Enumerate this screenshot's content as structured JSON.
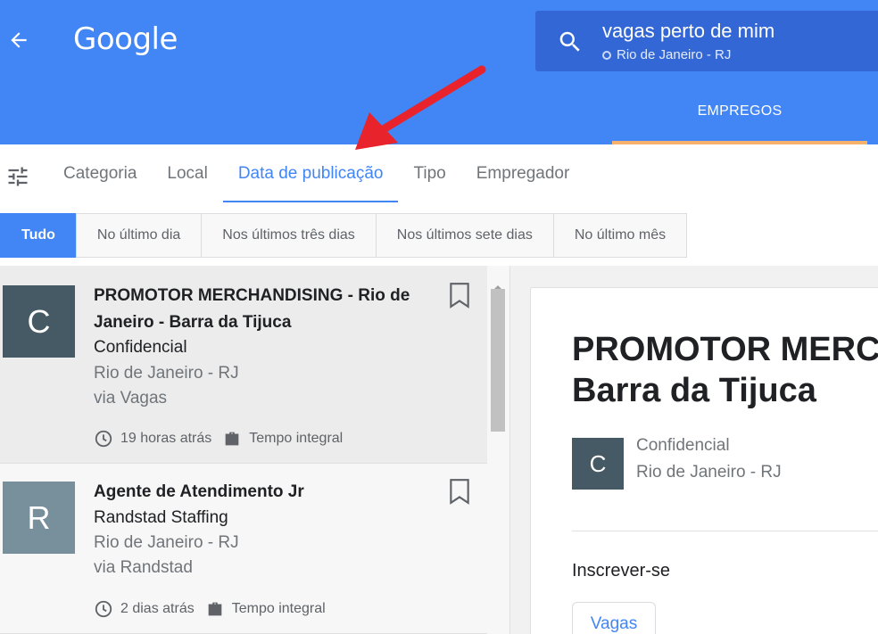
{
  "header": {
    "logo": "Google",
    "search": {
      "query": "vagas perto de mim",
      "location": "Rio de Janeiro - RJ"
    },
    "tab_label": "EMPREGOS"
  },
  "filters": {
    "tabs": [
      "Categoria",
      "Local",
      "Data de publicação",
      "Tipo",
      "Empregador"
    ],
    "active_tab": "Data de publicação",
    "chips": [
      "Tudo",
      "No último dia",
      "Nos últimos três dias",
      "Nos últimos sete dias",
      "No último mês"
    ],
    "active_chip": "Tudo"
  },
  "jobs": [
    {
      "avatar_letter": "C",
      "title": "PROMOTOR MERCHANDISING - Rio de Janeiro - Barra da Tijuca",
      "company": "Confidencial",
      "location": "Rio de Janeiro - RJ",
      "source": "via Vagas",
      "posted": "19 horas atrás",
      "type": "Tempo integral"
    },
    {
      "avatar_letter": "R",
      "title": "Agente de Atendimento Jr",
      "company": "Randstad Staffing",
      "location": "Rio de Janeiro - RJ",
      "source": "via Randstad",
      "posted": "2 dias atrás",
      "type": "Tempo integral"
    }
  ],
  "detail": {
    "title_line1": "PROMOTOR MERCHANDISING - Rio de Janeiro -",
    "title_line2": "Barra da Tijuca",
    "avatar_letter": "C",
    "company": "Confidencial",
    "location": "Rio de Janeiro - RJ",
    "apply_heading": "Inscrever-se",
    "apply_button": "Vagas"
  },
  "colors": {
    "header_blue": "#4285f4",
    "search_blue": "#3367d6",
    "tab_underline": "#f6b26b",
    "annotation_red": "#e8232b"
  }
}
